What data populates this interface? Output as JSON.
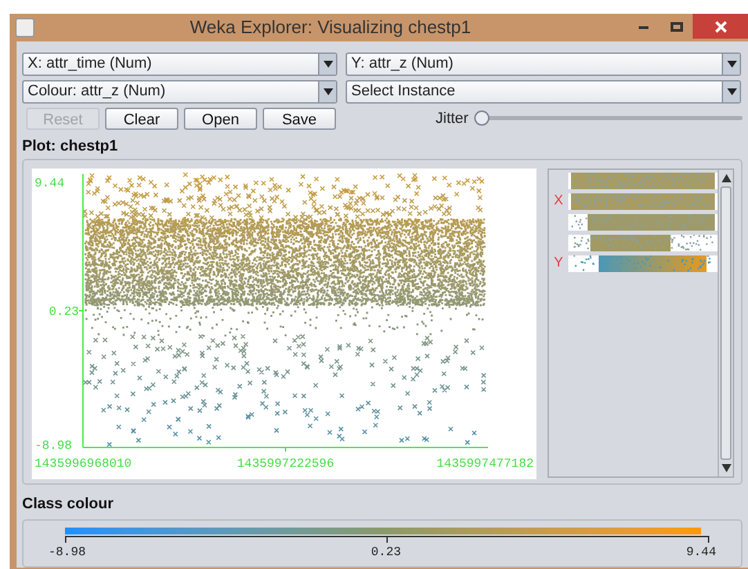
{
  "window": {
    "title": "Weka Explorer: Visualizing chestp1"
  },
  "selectors": [
    {
      "value": "X: attr_time (Num)"
    },
    {
      "value": "Y: attr_z (Num)"
    },
    {
      "value": "Colour: attr_z (Num)"
    },
    {
      "value": "Select Instance"
    }
  ],
  "buttons": [
    {
      "label": "Reset",
      "disabled": true
    },
    {
      "label": "Clear",
      "disabled": false
    },
    {
      "label": "Open",
      "disabled": false
    },
    {
      "label": "Save",
      "disabled": false
    }
  ],
  "jitter": {
    "label": "Jitter",
    "level": 0
  },
  "plot": {
    "title": "Plot: chestp1",
    "y_labels": [
      "9.44",
      "0.23",
      "-8.98"
    ],
    "x_labels": [
      "1435996968010",
      "1435997222596",
      "1435997477182"
    ]
  },
  "attribute_bars": [
    {
      "kind": "uniform"
    },
    {
      "kind": "uniform",
      "marker": "X"
    },
    {
      "kind": "sparse_left"
    },
    {
      "kind": "spread"
    },
    {
      "kind": "gradient",
      "marker": "Y"
    }
  ],
  "class_colour": {
    "title": "Class colour",
    "labels": [
      "-8.98",
      "0.23",
      "9.44"
    ]
  }
}
